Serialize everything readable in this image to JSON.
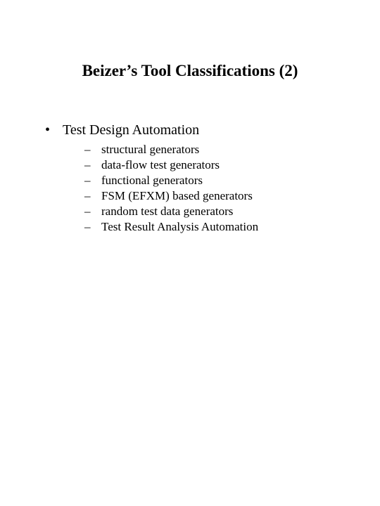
{
  "title": "Beizer’s Tool Classifications (2)",
  "bullet": {
    "heading": "Test Design Automation",
    "items": [
      "structural generators",
      "data-flow test generators",
      "functional generators",
      "FSM (EFXM) based generators",
      "random test data generators",
      "Test Result Analysis Automation"
    ]
  }
}
